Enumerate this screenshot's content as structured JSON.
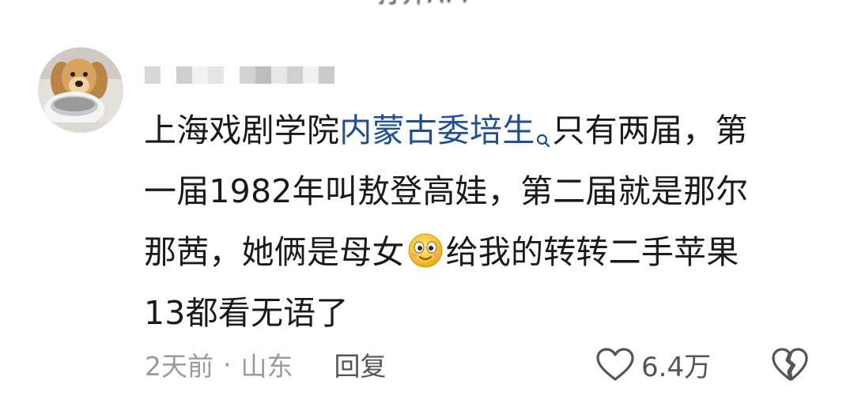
{
  "header": {
    "cut_text": "打开APP"
  },
  "comment": {
    "user": {
      "avatar_icon": "dog-avatar-icon",
      "username_pixelated": true
    },
    "lines": [
      {
        "before": "上海戏剧学院",
        "link": "内蒙古委培生",
        "after": "只有两届，第"
      },
      {
        "text": "一届1982年叫敖登高娃，第二届就是那尔"
      },
      {
        "before": "那茜，她俩是母女",
        "emoji": "smiling-face-emoji",
        "after": "给我的转转二手苹果"
      },
      {
        "text": "13都看无语了"
      }
    ],
    "link_color": "#1f4f91",
    "search_icon": "search-icon"
  },
  "meta": {
    "time": "2天前",
    "separator": "·",
    "location": "山东",
    "reply_label": "回复",
    "like_icon": "heart-outline-icon",
    "like_count": "6.4万",
    "dislike_icon": "broken-heart-icon"
  }
}
